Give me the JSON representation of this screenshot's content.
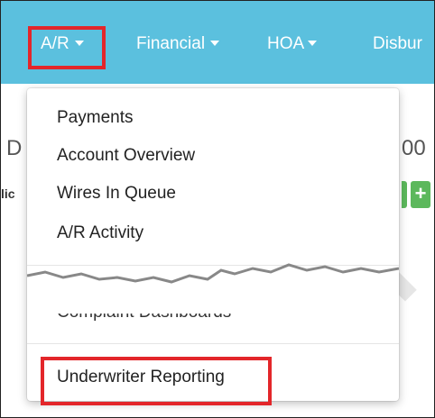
{
  "navbar": {
    "items": [
      {
        "label": "A/R"
      },
      {
        "label": "Financial"
      },
      {
        "label": "HOA"
      },
      {
        "label": "Disbur"
      }
    ]
  },
  "background": {
    "left_fragment": "D",
    "right_fragment": "00",
    "small_fragment": "lic",
    "add_button": "+"
  },
  "dropdown": {
    "items": [
      {
        "label": "Payments"
      },
      {
        "label": "Account Overview"
      },
      {
        "label": "Wires In Queue"
      },
      {
        "label": "A/R Activity"
      }
    ],
    "partial_item": "Complaint Dashboards",
    "bottom_item": "Underwriter Reporting"
  },
  "colors": {
    "navbar": "#5bc0de",
    "highlight": "#e3262a",
    "add_button": "#5cb85c"
  }
}
